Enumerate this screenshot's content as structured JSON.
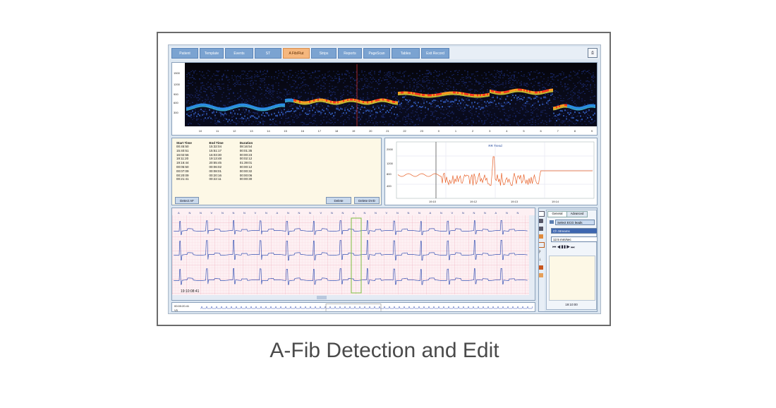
{
  "caption": "A-Fib Detection and Edit",
  "tabs": [
    {
      "label": "Patient",
      "active": false
    },
    {
      "label": "Template",
      "active": false
    },
    {
      "label": "Events",
      "active": false
    },
    {
      "label": "ST",
      "active": false
    },
    {
      "label": "A Fib/Flut",
      "active": true
    },
    {
      "label": "Strips",
      "active": false
    },
    {
      "label": "Reports",
      "active": false
    },
    {
      "label": "PageScan",
      "active": false
    },
    {
      "label": "Tables",
      "active": false
    },
    {
      "label": "Exit Record",
      "active": false
    }
  ],
  "toolbar_icon": "print-icon",
  "spectrogram": {
    "y_ticks": [
      "1500",
      "1200",
      "900",
      "600",
      "300"
    ],
    "x_ticks": [
      "10",
      "11",
      "12",
      "13",
      "14",
      "15",
      "16",
      "17",
      "18",
      "19",
      "20",
      "21",
      "22",
      "23",
      "0",
      "1",
      "2",
      "3",
      "4",
      "5",
      "6",
      "7",
      "8",
      "9"
    ]
  },
  "events": {
    "headers": [
      "Start Time",
      "End Time",
      "Duration"
    ],
    "rows": [
      [
        "00:45:50",
        "15:32:04",
        "08:16:54"
      ],
      [
        "15:40:51",
        "15:51:17",
        "00:01:35"
      ],
      [
        "16:02:56",
        "16:03:30",
        "00:00:23"
      ],
      [
        "19:11:20",
        "19:13:48",
        "00:02:12"
      ],
      [
        "19:16:44",
        "20:55:45",
        "01:39:01"
      ],
      [
        "00:05:50",
        "00:06:02",
        "00:00:12"
      ],
      [
        "00:07:09",
        "00:08:01",
        "00:00:32"
      ],
      [
        "00:20:09",
        "00:20:16",
        "00:00:06"
      ],
      [
        "00:21:41",
        "00:22:11",
        "00:00:30"
      ]
    ],
    "btn_detect": "Detect AF",
    "btn_delete": "Delete",
    "btn_delete_dvd": "Delete DVD"
  },
  "trend": {
    "title": "RR Trend",
    "y_ticks": [
      "2000",
      "1200",
      "800",
      "400"
    ],
    "x_ticks": [
      "19:10",
      "19:12",
      "19:13",
      "19:14"
    ]
  },
  "ecg": {
    "timestamp": "19:10:08:41",
    "beat_labels": [
      "A",
      "N",
      "N",
      "V",
      "N",
      "N",
      "N",
      "V",
      "N",
      "A",
      "N",
      "N",
      "N",
      "V",
      "N",
      "N",
      "A",
      "N",
      "N",
      "V",
      "N",
      "N",
      "N",
      "A",
      "N",
      "V",
      "N",
      "N",
      "N",
      "A",
      "N",
      "N"
    ]
  },
  "strip": {
    "time": "00:00:20.41",
    "label": "V5"
  },
  "control": {
    "tab_general": "General",
    "tab_advanced": "Advanced",
    "select_leads_label": "Select ECG leads",
    "lead_value": "Ch Streams",
    "speed_value": "12.5 mm/sec",
    "time_value": "19:10:00"
  }
}
